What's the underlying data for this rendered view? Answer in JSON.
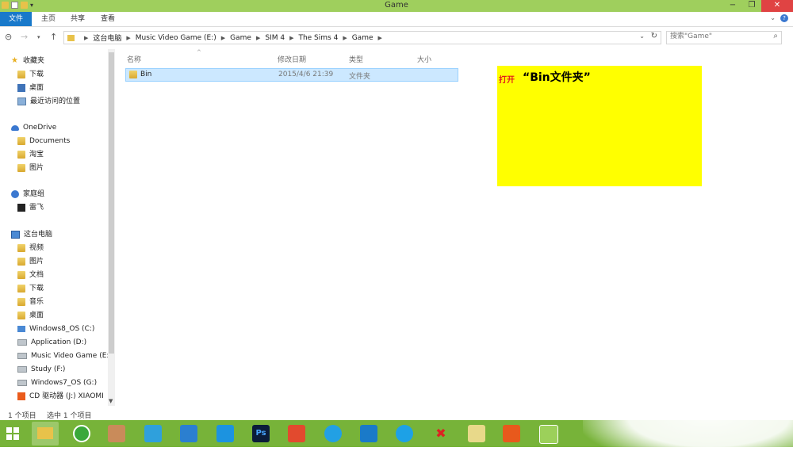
{
  "window": {
    "title": "Game"
  },
  "ribbon": {
    "tabs": [
      "文件",
      "主页",
      "共享",
      "查看"
    ],
    "help": "?"
  },
  "address": {
    "crumbs": [
      "这台电脑",
      "Music Video Game (E:)",
      "Game",
      "SIM 4",
      "The Sims 4",
      "Game"
    ]
  },
  "search": {
    "placeholder": "搜索\"Game\""
  },
  "nav": {
    "favorites": {
      "header": "收藏夹",
      "items": [
        "下载",
        "桌面",
        "最近访问的位置"
      ]
    },
    "onedrive": {
      "header": "OneDrive",
      "items": [
        "Documents",
        "淘宝",
        "图片"
      ]
    },
    "homegroup": {
      "header": "家庭组",
      "items": [
        "雷飞"
      ]
    },
    "thispc": {
      "header": "这台电脑",
      "items": [
        "视频",
        "图片",
        "文档",
        "下载",
        "音乐",
        "桌面",
        "Windows8_OS (C:)",
        "Application (D:)",
        "Music Video Game (E:)",
        "Study (F:)",
        "Windows7_OS (G:)",
        "CD 驱动器 (J:) XIAOMI"
      ]
    }
  },
  "columns": {
    "name": "名称",
    "modified": "修改日期",
    "type": "类型",
    "size": "大小"
  },
  "files": [
    {
      "name": "Bin",
      "modified": "2015/4/6 21:39",
      "type": "文件夹",
      "size": ""
    }
  ],
  "annotation": {
    "action": "打开",
    "target": "“Bin文件夹”"
  },
  "status": {
    "count": "1 个项目",
    "selected": "选中 1 个项目"
  },
  "taskbar": {
    "apps": [
      "start",
      "file-explorer",
      "360-browser",
      "paint",
      "baidu-cloud",
      "network-app",
      "feiq-messenger",
      "photoshop",
      "game-app",
      "qq-app",
      "cloud-app",
      "browser-app",
      "x-app",
      "book-app",
      "mi-app",
      "chat-app"
    ]
  }
}
